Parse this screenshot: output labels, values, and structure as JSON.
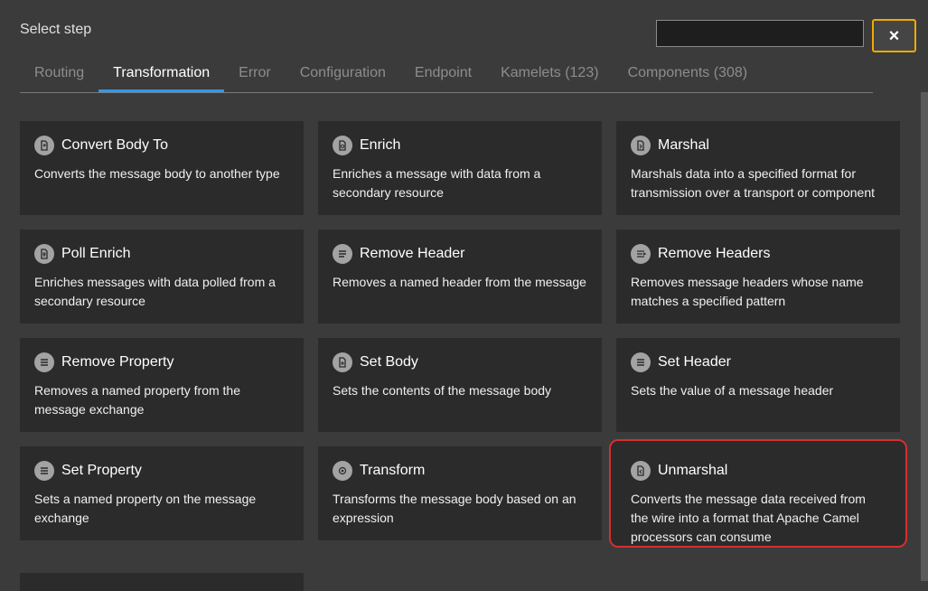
{
  "header": {
    "title": "Select step"
  },
  "search": {
    "value": "",
    "placeholder": ""
  },
  "close_button": {
    "label": "×"
  },
  "tabs": [
    {
      "label": "Routing",
      "active": false
    },
    {
      "label": "Transformation",
      "active": true
    },
    {
      "label": "Error",
      "active": false
    },
    {
      "label": "Configuration",
      "active": false
    },
    {
      "label": "Endpoint",
      "active": false
    },
    {
      "label": "Kamelets (123)",
      "active": false
    },
    {
      "label": "Components (308)",
      "active": false
    }
  ],
  "steps": [
    {
      "title": "Convert Body To",
      "description": "Converts the message body to another type",
      "icon": "convert-icon"
    },
    {
      "title": "Enrich",
      "description": "Enriches a message with data from a secondary resource",
      "icon": "enrich-icon"
    },
    {
      "title": "Marshal",
      "description": "Marshals data into a specified format for transmission over a transport or component",
      "icon": "marshal-icon"
    },
    {
      "title": "Poll Enrich",
      "description": "Enriches messages with data polled from a secondary resource",
      "icon": "poll-enrich-icon"
    },
    {
      "title": "Remove Header",
      "description": "Removes a named header from the message",
      "icon": "remove-header-icon"
    },
    {
      "title": "Remove Headers",
      "description": "Removes message headers whose name matches a specified pattern",
      "icon": "remove-headers-icon"
    },
    {
      "title": "Remove Property",
      "description": "Removes a named property from the message exchange",
      "icon": "remove-property-icon"
    },
    {
      "title": "Set Body",
      "description": "Sets the contents of the message body",
      "icon": "set-body-icon"
    },
    {
      "title": "Set Header",
      "description": "Sets the value of a message header",
      "icon": "set-header-icon"
    },
    {
      "title": "Set Property",
      "description": "Sets a named property on the message exchange",
      "icon": "set-property-icon"
    },
    {
      "title": "Transform",
      "description": "Transforms the message body based on an expression",
      "icon": "transform-icon"
    },
    {
      "title": "Unmarshal",
      "description": "Converts the message data received from the wire into a format that Apache Camel processors can consume",
      "icon": "unmarshal-icon",
      "selected": true
    }
  ],
  "colors": {
    "background": "#3b3b3b",
    "card": "#2b2b2b",
    "active_tab_underline": "#2b9af3",
    "close_border": "#f0ab00",
    "selection_outline": "#d62e2e"
  }
}
